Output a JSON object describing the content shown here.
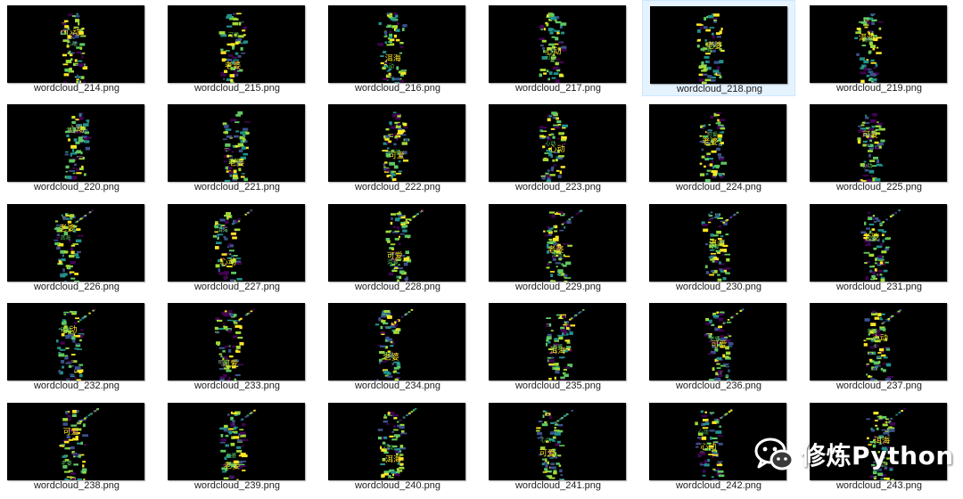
{
  "files": [
    "wordcloud_214.png",
    "wordcloud_215.png",
    "wordcloud_216.png",
    "wordcloud_217.png",
    "wordcloud_218.png",
    "wordcloud_219.png",
    "wordcloud_220.png",
    "wordcloud_221.png",
    "wordcloud_222.png",
    "wordcloud_223.png",
    "wordcloud_224.png",
    "wordcloud_225.png",
    "wordcloud_226.png",
    "wordcloud_227.png",
    "wordcloud_228.png",
    "wordcloud_229.png",
    "wordcloud_230.png",
    "wordcloud_231.png",
    "wordcloud_232.png",
    "wordcloud_233.png",
    "wordcloud_234.png",
    "wordcloud_235.png",
    "wordcloud_236.png",
    "wordcloud_237.png",
    "wordcloud_238.png",
    "wordcloud_239.png",
    "wordcloud_240.png",
    "wordcloud_241.png",
    "wordcloud_242.png",
    "wordcloud_243.png"
  ],
  "selected_file": "wordcloud_218.png",
  "thumbnail_words": [
    "老婆",
    "可爱",
    "洱海",
    "心动"
  ],
  "thumbnail_colors": [
    "#fde725",
    "#5ec962",
    "#21918c",
    "#3b528b",
    "#440154",
    "#a0da39"
  ],
  "watermark": {
    "icon": "wechat-icon",
    "text": "修炼Python"
  }
}
